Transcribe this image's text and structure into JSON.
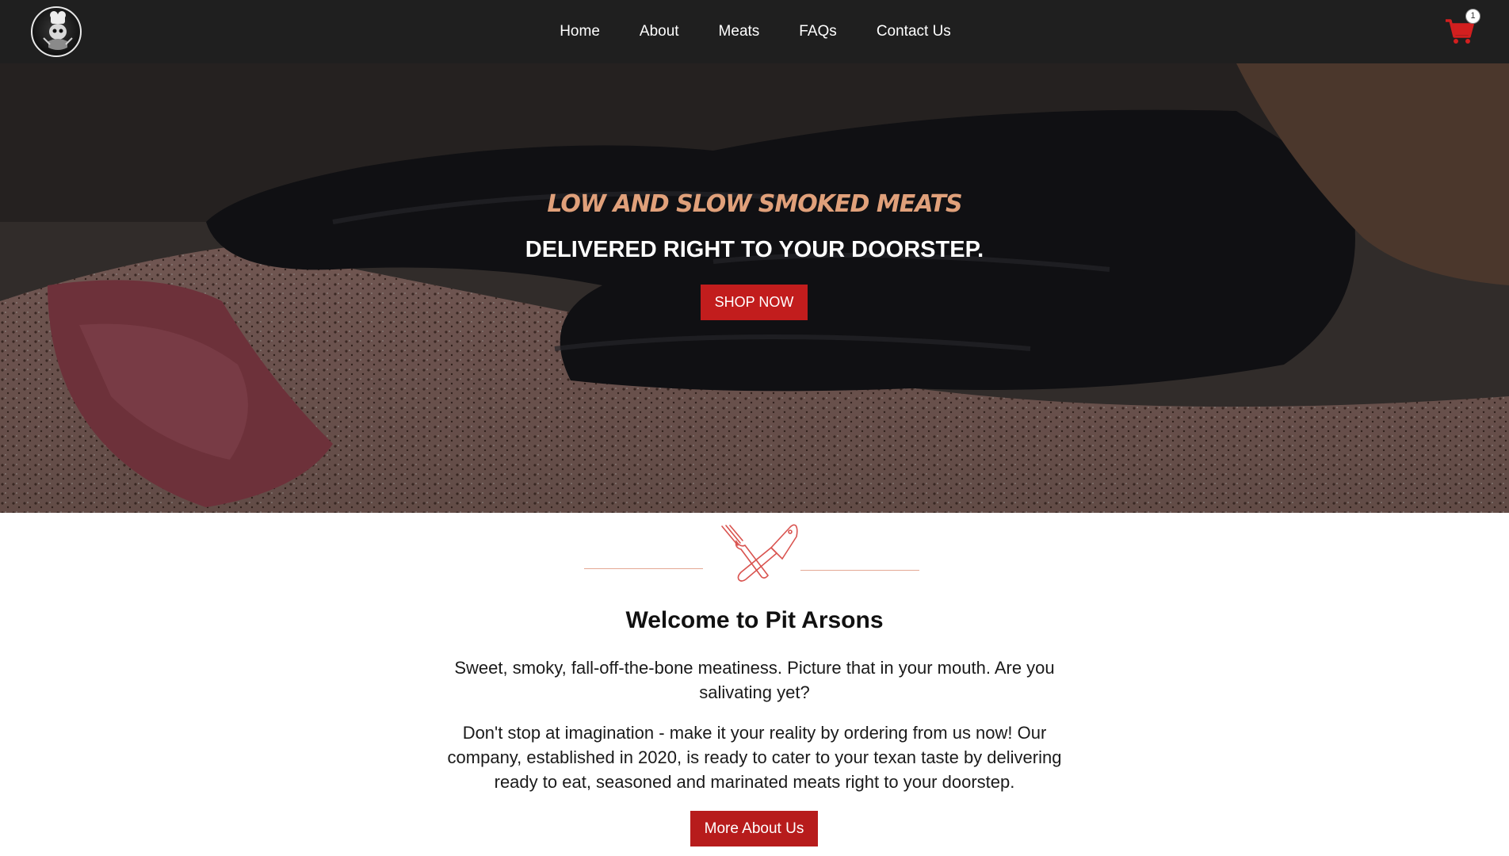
{
  "header": {
    "logo_icon": "pit-arsons-logo",
    "nav": [
      {
        "label": "Home"
      },
      {
        "label": "About"
      },
      {
        "label": "Meats"
      },
      {
        "label": "FAQs"
      },
      {
        "label": "Contact Us"
      }
    ],
    "cart_icon": "shopping-cart-icon",
    "cart_count": "1"
  },
  "hero": {
    "tagline": "LOW AND SLOW SMOKED MEATS",
    "subtitle": "DELIVERED RIGHT TO YOUR DOORSTEP.",
    "shop_button": "SHOP NOW"
  },
  "welcome": {
    "icon": "crossed-knife-cleaver-icon",
    "title": "Welcome to Pit Arsons",
    "paragraph_1": "Sweet, smoky, fall-off-the-bone meatiness. Picture that in your mouth. Are you salivating yet?",
    "paragraph_2": "Don't stop at imagination - make it your reality by ordering from us now! Our company, established in 2020, is ready to cater to your texan taste by delivering ready to eat, seasoned and marinated meats right to your doorstep.",
    "more_button": "More About Us"
  },
  "colors": {
    "header_bg": "#1f1f1f",
    "accent_red": "#c21d1d",
    "tagline_color": "#e0a07a",
    "divider_color": "#e4a894"
  }
}
